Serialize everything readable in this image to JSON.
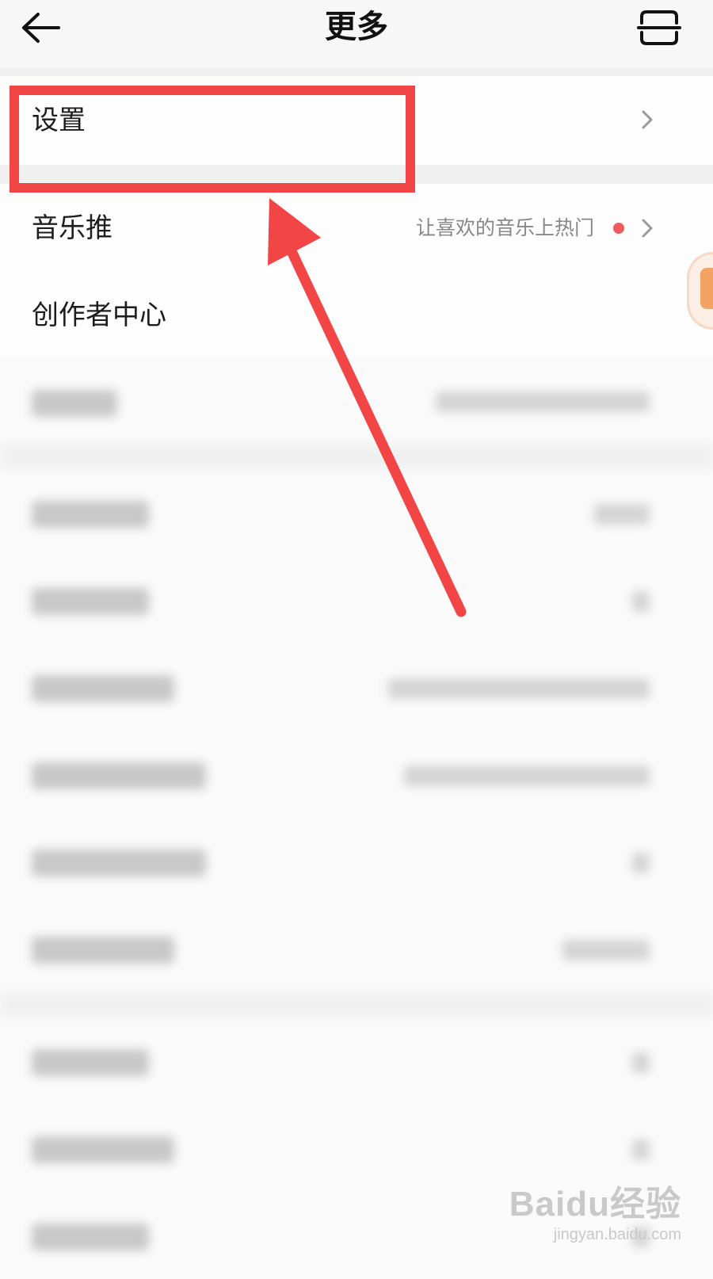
{
  "header": {
    "title": "更多",
    "back_icon": "arrow-left-icon",
    "scan_icon": "scan-icon"
  },
  "rows": {
    "settings": {
      "label": "设置"
    },
    "music_push": {
      "label": "音乐推",
      "desc": "让喜欢的音乐上热门"
    },
    "creator_center": {
      "label": "创作者中心"
    }
  },
  "colors": {
    "highlight": "#f24545",
    "badge_dot": "#f05a5a"
  },
  "watermark": {
    "logo": "Baidu经验",
    "url": "jingyan.baidu.com"
  }
}
